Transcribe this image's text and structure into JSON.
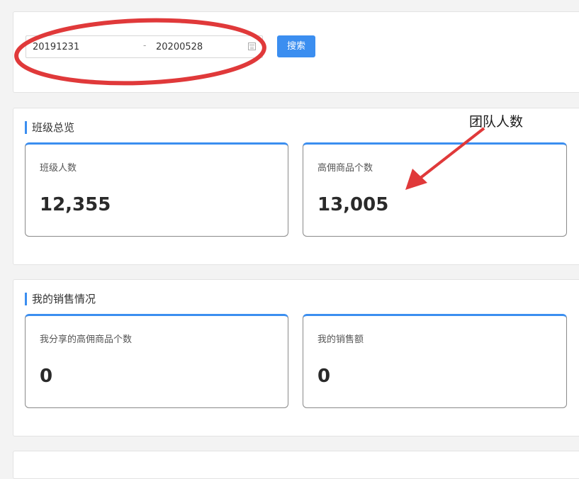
{
  "filter": {
    "start_date": "20191231",
    "separator": "-",
    "end_date": "20200528",
    "search_label": "搜索"
  },
  "overview": {
    "title": "班级总览",
    "cards": [
      {
        "label": "班级人数",
        "value": "12,355"
      },
      {
        "label": "高佣商品个数",
        "value": "13,005"
      }
    ]
  },
  "sales": {
    "title": "我的销售情况",
    "cards": [
      {
        "label": "我分享的高佣商品个数",
        "value": "0"
      },
      {
        "label": "我的销售额",
        "value": "0"
      }
    ]
  },
  "annotation": {
    "text": "团队人数",
    "color": "#e0393a"
  },
  "colors": {
    "accent": "#3b8ef0",
    "annotation_red": "#e0393a"
  }
}
